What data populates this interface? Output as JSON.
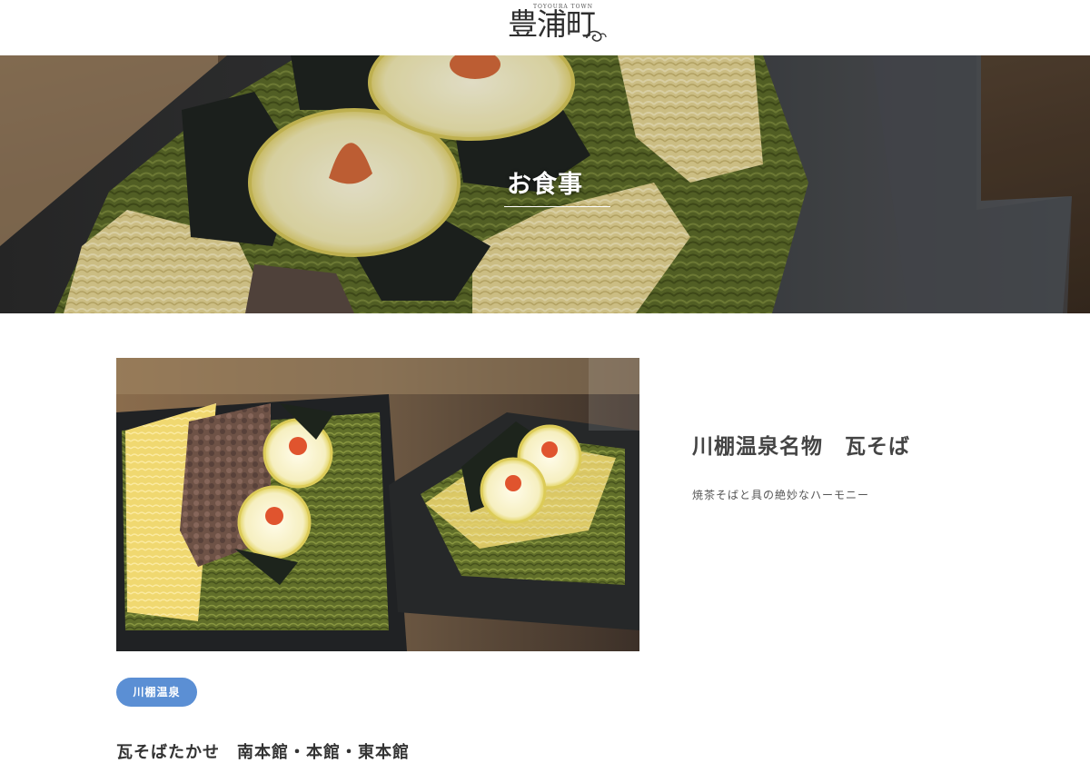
{
  "header": {
    "logo_text": "豊浦町",
    "logo_subtext": "TOYOURA TOWN"
  },
  "hero": {
    "title": "お食事"
  },
  "feature": {
    "dish_name": "川棚温泉名物　瓦そば",
    "description": "焼茶そばと具の絶妙なハーモニー",
    "area_tag": "川棚温泉",
    "shop_name": "瓦そばたかせ　南本館・本館・東本館"
  },
  "colors": {
    "accent": "#5b8fd4",
    "text": "#333333"
  }
}
